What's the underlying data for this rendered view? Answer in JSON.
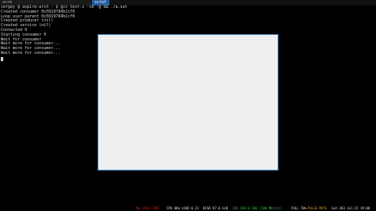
{
  "tabs": [
    {
      "label": "scre"
    },
    {
      "label": "scrot"
    }
  ],
  "terminal": {
    "lines": [
      "sergey @ aspire-arch : $ gcc test.c -lm -g && ./a.out",
      "Created consumer 0x5019784b1cf0",
      "Loop user parent 0x5019784b1cf0",
      "Created producer (nil)",
      "Created service (nil)",
      "Connected 0",
      "Starting consumer 0",
      "Wait for consumer",
      "Wait more for consumer...",
      "Wait more for consumer...",
      "Wait more for consumer..."
    ]
  },
  "statusbar": {
    "segments": [
      {
        "text": "No IPv6 CONF",
        "color": "#cc2222"
      },
      {
        "text": "CPU 06%",
        "color": "#e0e0e0"
      },
      {
        "text": "LOAD 0.23",
        "color": "#e0e0e0"
      },
      {
        "text": "DISK 87.0 GiB",
        "color": "#e0e0e0"
      },
      {
        "text": "192.168.0.106 (100 Mbit/s)",
        "color": "#33cc44"
      },
      {
        "text": "FULL 70%",
        "color": "#e0e0e0"
      },
      {
        "text": "PULSE MUTE",
        "color": "#d9a33a"
      },
      {
        "text": "Sat-203 Jul-22 19:00",
        "color": "#e0e0e0"
      }
    ]
  }
}
